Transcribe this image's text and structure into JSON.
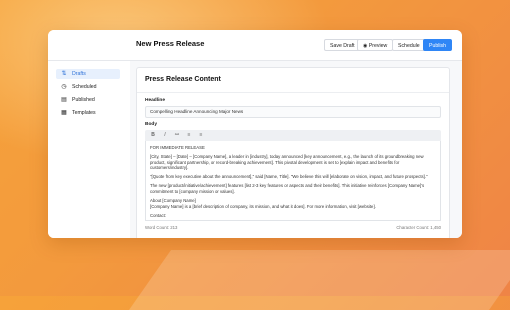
{
  "header": {
    "title": "New Press Release",
    "buttons": {
      "save_draft": "Save Draft",
      "preview": "Preview",
      "schedule": "Schedule",
      "publish": "Publish"
    }
  },
  "sidebar": {
    "items": [
      {
        "label": "Drafts",
        "icon": "drafts-icon",
        "active": true
      },
      {
        "label": "Scheduled",
        "icon": "clock-icon",
        "active": false
      },
      {
        "label": "Published",
        "icon": "calendar-icon",
        "active": false
      },
      {
        "label": "Templates",
        "icon": "grid-icon",
        "active": false
      }
    ]
  },
  "card": {
    "title": "Press Release Content",
    "headline_label": "Headline",
    "headline_value": "Compelling Headline Announcing Major News",
    "body_label": "Body",
    "toolbar": [
      "B",
      "I",
      "link",
      "list",
      "list"
    ],
    "body_paragraphs": [
      "FOR IMMEDIATE RELEASE",
      "[City, State] – [Date] – [Company Name], a leader in [industry], today announced [key announcement, e.g., the launch of its groundbreaking new product, significant partnership, or record-breaking achievement]. This pivotal development is set to [explain impact and benefits for customers/industry].",
      "\"[Quote from key executive about the announcement],\" said [Name, Title]. \"We believe this will [elaborate on vision, impact, and future prospects].\"",
      "The new [product/initiative/achievement] features [list 2-3 key features or aspects and their benefits]. This initiative reinforces [Company Name]'s commitment to [company mission or values].",
      "About [Company Name]\n[Company Name] is a [brief description of company, its mission, and what it does]. For more information, visit [website].",
      "Contact:"
    ],
    "word_count": "Word Count: 213",
    "char_count": "Character Count: 1,450"
  },
  "colors": {
    "accent": "#2f86f6",
    "background_orange": "#f39a3d"
  }
}
